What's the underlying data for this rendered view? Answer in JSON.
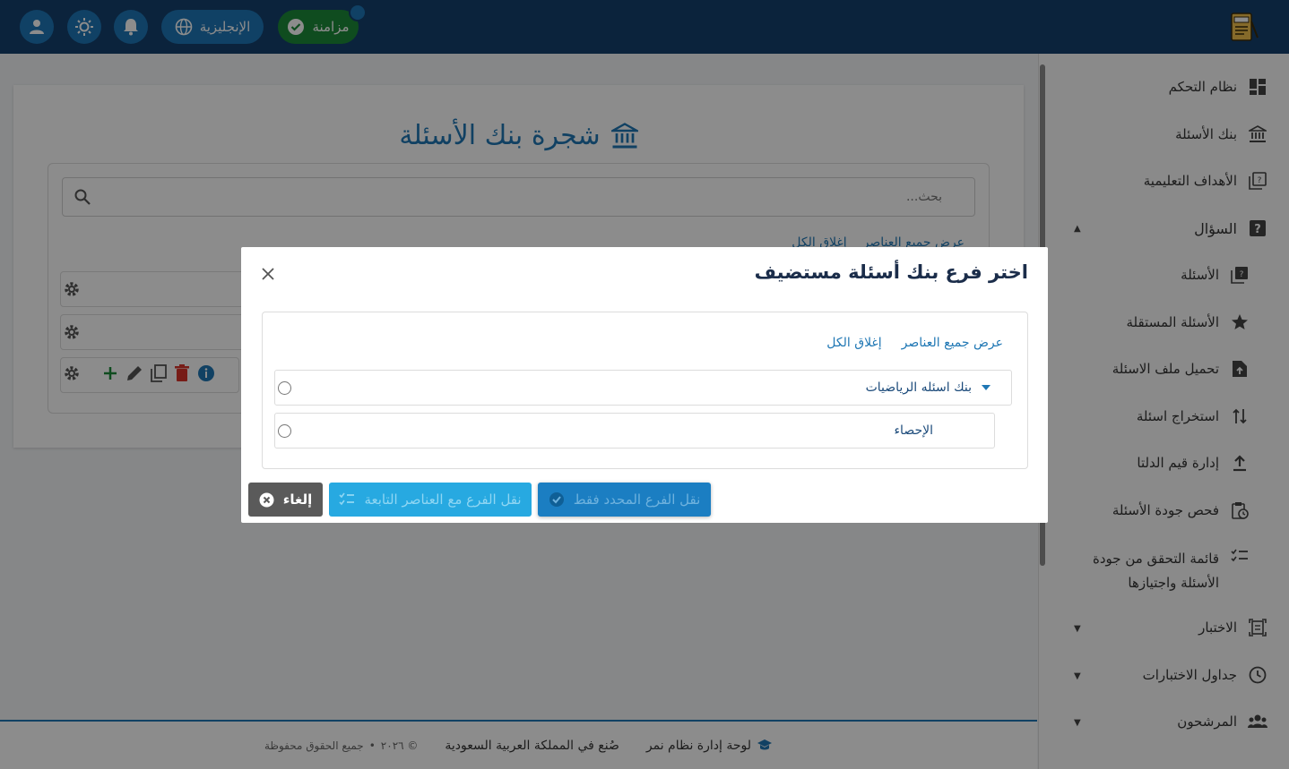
{
  "topbar": {
    "sync_label": "مزامنة",
    "language_label": "الإنجليزية",
    "icons": [
      "user-icon",
      "sun-icon",
      "bell-icon",
      "globe-icon",
      "check-icon"
    ]
  },
  "sidebar": {
    "items": [
      {
        "label": "نظام التحكم",
        "icon": "dashboard-icon"
      },
      {
        "label": "بنك الأسئلة",
        "icon": "bank-icon"
      },
      {
        "label": "الأهداف التعليمية",
        "icon": "objectives-icon"
      },
      {
        "label": "السؤال",
        "icon": "question-icon",
        "expanded": true
      },
      {
        "label": "الأسئلة",
        "icon": "questions-icon"
      },
      {
        "label": "الأسئلة المستقلة",
        "icon": "star-icon"
      },
      {
        "label": "تحميل ملف الاسئلة",
        "icon": "file-upload-icon"
      },
      {
        "label": "استخراج اسئلة",
        "icon": "sort-icon"
      },
      {
        "label": "إدارة قيم الدلتا",
        "icon": "upload-icon"
      },
      {
        "label": "فحص جودة الأسئلة",
        "icon": "clipboard-clock-icon"
      },
      {
        "label": "قائمة التحقق من جودة",
        "label2": "الأسئلة واجتيازها",
        "icon": "checklist-icon"
      },
      {
        "label": "الاختبار",
        "icon": "exam-icon"
      },
      {
        "label": "جداول الاختبارات",
        "icon": "clock-icon"
      },
      {
        "label": "المرشحون",
        "icon": "people-icon"
      }
    ]
  },
  "page": {
    "title": "شجرة بنك الأسئلة",
    "search_placeholder": "بحث...",
    "show_all": "عرض جميع العناصر",
    "close_all": "إغلاق الكل"
  },
  "modal": {
    "title": "اختر فرع بنك أسئلة مستضيف",
    "show_all": "عرض جميع العناصر",
    "close_all": "إغلاق الكل",
    "nodes": [
      {
        "label": "بنك اسئله الرياضيات",
        "expanded": true
      },
      {
        "label": "الإحصاء"
      }
    ],
    "buttons": {
      "cancel": "إلغاء",
      "move_with_children": "نقل الفرع مع العناصر التابعة",
      "move_selected_only": "نقل الفرع المحدد فقط"
    }
  },
  "footer": {
    "dashboard": "لوحة إدارة نظام نمر",
    "made_in": "صُنع في المملكة العربية السعودية",
    "year": "© ٢٠٢٦",
    "rights": "جميع الحقوق محفوظة"
  },
  "colors": {
    "topbar": "#14416e",
    "primary": "#1f77b4",
    "success": "#1c8a3a"
  }
}
